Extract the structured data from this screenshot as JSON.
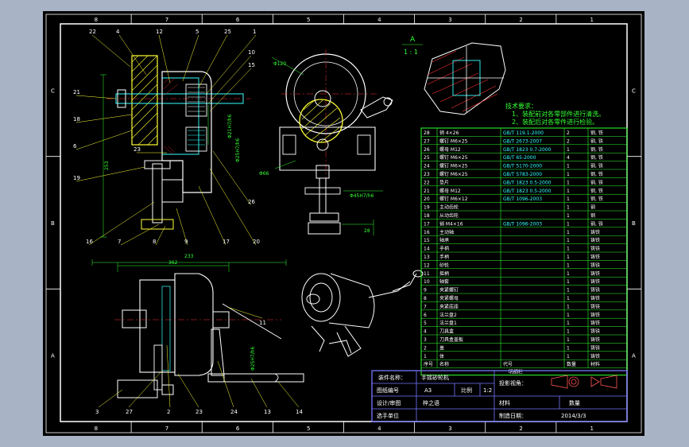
{
  "colors": {
    "background": "#000000",
    "frame": "#ffffff",
    "part_outline": "#33ffff",
    "dimension": "#33ff33",
    "leader": "#ffff33",
    "section_fill": "#ff3333",
    "notes": "#33ff33",
    "table_lines": "#33ff33",
    "title_frame": "#7777ff",
    "page_bg": "#a8b4c6"
  },
  "zone_labels": {
    "top": [
      "8",
      "7",
      "6",
      "5",
      "4",
      "3",
      "2",
      "1"
    ],
    "bottom": [
      "8",
      "7",
      "6",
      "5",
      "4",
      "3",
      "2",
      "1"
    ],
    "left": [
      "C",
      "B",
      "A"
    ],
    "right": [
      "C",
      "B",
      "A"
    ]
  },
  "detail_view": {
    "letter": "A",
    "scale": "1 : 1"
  },
  "tech_notes": {
    "title": "技术要求：",
    "items": [
      "1、装配前对各零部件进行清洗。",
      "2、装配后对各零件进行检验。"
    ]
  },
  "dimensions": {
    "front": [
      "Φ120",
      "Φ66",
      "Φ45H7/h6",
      "28"
    ],
    "side": [
      "Φ21H7/h6",
      "Φ25H7/h6",
      "253",
      "28"
    ],
    "bottom": [
      "362",
      "233",
      "Φ25H7/h6"
    ]
  },
  "balloons": {
    "side_view": [
      "22",
      "4",
      "12",
      "5",
      "25",
      "1",
      "10",
      "15",
      "21",
      "18",
      "6",
      "19",
      "16",
      "7",
      "8",
      "9",
      "17",
      "20",
      "26",
      "23"
    ],
    "bottom_view": [
      "3",
      "27",
      "2",
      "23",
      "24",
      "13",
      "14",
      "11"
    ]
  },
  "parts_table": {
    "headers": [
      "序号",
      "名称",
      "代号",
      "数量",
      "材料"
    ],
    "rows": [
      [
        "28",
        "销 4×26",
        "GB/T 119.1-2000",
        "2",
        "钢, 铁"
      ],
      [
        "27",
        "螺钉 M6×25",
        "GB/T 2673-2007",
        "2",
        "钢, 铁"
      ],
      [
        "26",
        "螺母 M12",
        "GB/T 1823 0.7-2000",
        "1",
        "钢, 铁"
      ],
      [
        "25",
        "螺钉 M6×25",
        "GB/T 65-2000",
        "4",
        "钢, 铁"
      ],
      [
        "24",
        "螺钉 M6×25",
        "GB/T 5170-2000",
        "1",
        "钢, 铁"
      ],
      [
        "23",
        "螺钉 M6×25",
        "GB/T 5783-2000",
        "1",
        "钢, 铁"
      ],
      [
        "22",
        "垫片",
        "GB/T 1823 0.5-2000",
        "1",
        "钢, 铁"
      ],
      [
        "21",
        "螺母 M12",
        "GB/T 1823 0.5-2000",
        "1",
        "钢, 铁"
      ],
      [
        "20",
        "螺钉 M6×12",
        "GB/T 1096-2003",
        "1",
        "钢, 铁"
      ],
      [
        "19",
        "主动齿轮",
        "",
        "1",
        "钢"
      ],
      [
        "18",
        "从动齿轮",
        "",
        "1",
        "钢"
      ],
      [
        "17",
        "销 M4×16",
        "GB/T 1096-2003",
        "1",
        "钢, 铁"
      ],
      [
        "16",
        "主动轴",
        "",
        "1",
        "铸铁"
      ],
      [
        "15",
        "轴承",
        "",
        "1",
        "铸铁"
      ],
      [
        "14",
        "手柄",
        "",
        "1",
        "铸铁"
      ],
      [
        "13",
        "手柄",
        "",
        "1",
        "铸铁"
      ],
      [
        "12",
        "砂轮",
        "",
        "1",
        "铸铁"
      ],
      [
        "11",
        "摇柄",
        "",
        "1",
        "铸铁"
      ],
      [
        "10",
        "轴套",
        "",
        "1",
        "铸铁"
      ],
      [
        "9",
        "夹紧螺钉",
        "",
        "1",
        "铸铁"
      ],
      [
        "8",
        "夹紧螺母",
        "",
        "1",
        "铸铁"
      ],
      [
        "7",
        "夹紧底座",
        "",
        "1",
        "铸铁"
      ],
      [
        "6",
        "法兰盘2",
        "",
        "1",
        "铸铁"
      ],
      [
        "5",
        "法兰盘1",
        "",
        "1",
        "铸铁"
      ],
      [
        "4",
        "刀具盒",
        "",
        "1",
        "铸铁"
      ],
      [
        "3",
        "刀具盒盖板",
        "",
        "1",
        "铸铁"
      ],
      [
        "2",
        "盖",
        "",
        "1",
        "铸铁"
      ],
      [
        "1",
        "体",
        "",
        "1",
        "铸铁"
      ]
    ],
    "footer": "明细栏"
  },
  "title_block": {
    "name_label": "装件名称：",
    "name_value": "手摇砂轮机",
    "drawing_no_label": "图纸编号",
    "drawing_no_value": "A3",
    "scale_label": "比例",
    "scale_value": "1:2",
    "design_label": "设计/审图",
    "designer": "梓之语",
    "unit_label": "选手单位",
    "projection_label": "投影视角：",
    "material_label": "材料",
    "quantity_label": "数量",
    "date_label": "制造日期：",
    "date_value": "2014/3/3"
  }
}
